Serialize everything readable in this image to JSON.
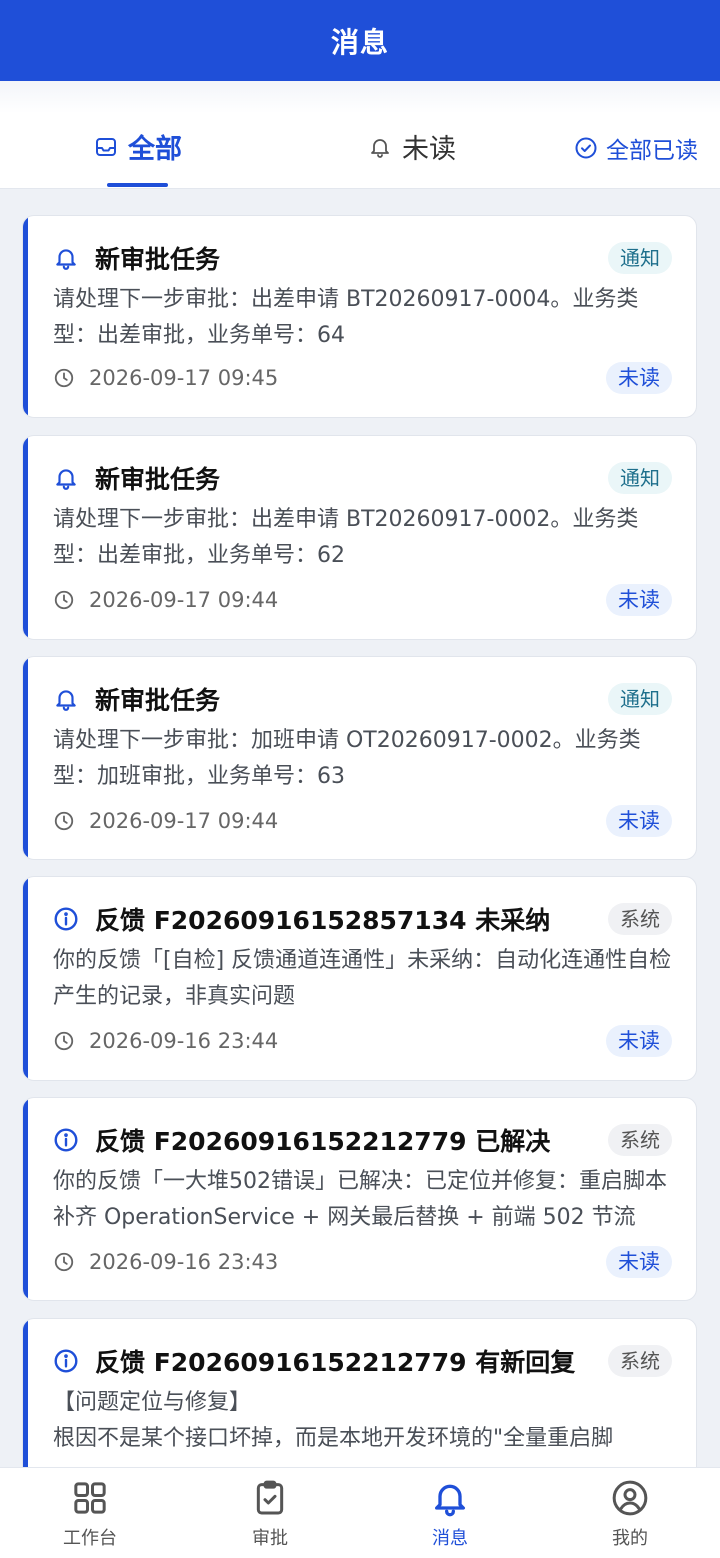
{
  "header": {
    "title": "消息"
  },
  "tabs": [
    {
      "label": "全部",
      "active": true
    },
    {
      "label": "未读",
      "active": false
    }
  ],
  "mark_all_read_label": "全部已读",
  "messages": [
    {
      "title": "新审批任务",
      "badge": "通知",
      "icon": "bell-icon",
      "body": "请处理下一步审批：出差申请 BT20260917-0004。业务类型：出差审批，业务单号：64",
      "time": "2026-09-17 09:45",
      "status": "未读"
    },
    {
      "title": "新审批任务",
      "badge": "通知",
      "icon": "bell-icon",
      "body": "请处理下一步审批：出差申请 BT20260917-0002。业务类型：出差审批，业务单号：62",
      "time": "2026-09-17 09:44",
      "status": "未读"
    },
    {
      "title": "新审批任务",
      "badge": "通知",
      "icon": "bell-icon",
      "body": "请处理下一步审批：加班申请 OT20260917-0002。业务类型：加班审批，业务单号：63",
      "time": "2026-09-17 09:44",
      "status": "未读"
    },
    {
      "title": "反馈 F20260916152857134 未采纳",
      "badge": "系统",
      "icon": "info-icon",
      "body": "你的反馈「[自检] 反馈通道连通性」未采纳：自动化连通性自检产生的记录，非真实问题",
      "time": "2026-09-16 23:44",
      "status": "未读"
    },
    {
      "title": "反馈 F20260916152212779 已解决",
      "badge": "系统",
      "icon": "info-icon",
      "body": "你的反馈「一大堆502错误」已解决：已定位并修复：重启脚本补齐 OperationService + 网关最后替换 + 前端 502 节流",
      "time": "2026-09-16 23:43",
      "status": "未读"
    },
    {
      "title": "反馈 F20260916152212779 有新回复",
      "badge": "系统",
      "icon": "info-icon",
      "body": "【问题定位与修复】\n根因不是某个接口坏掉，而是本地开发环境的\"全量重启脚",
      "time": "",
      "status": ""
    }
  ],
  "bottom_nav": [
    {
      "label": "工作台",
      "icon": "grid-icon",
      "active": false
    },
    {
      "label": "审批",
      "icon": "clipboard-check-icon",
      "active": false
    },
    {
      "label": "消息",
      "icon": "bell-icon",
      "active": true
    },
    {
      "label": "我的",
      "icon": "user-circle-icon",
      "active": false
    }
  ],
  "colors": {
    "primary": "#1f4fd8",
    "background": "#eef1f6",
    "notice_badge": "#eaf6f8",
    "unread_badge": "#eaf1fd"
  }
}
